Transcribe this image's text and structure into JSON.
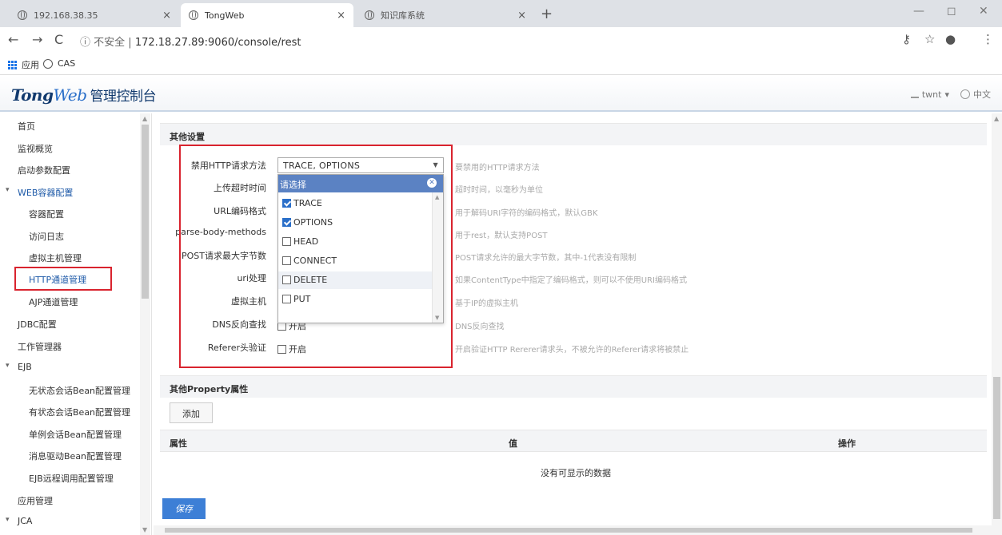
{
  "browser": {
    "tabs": [
      {
        "title": "192.168.38.35"
      },
      {
        "title": "TongWeb"
      },
      {
        "title": "知识库系统"
      }
    ],
    "url_prefix": "不安全",
    "url": "172.18.27.89:9060/console/rest",
    "bookmarks": {
      "apps": "应用",
      "cas": "CAS"
    }
  },
  "app": {
    "logo_main": "Tong",
    "logo_web": "Web",
    "logo_cn": "管理控制台",
    "user": "twnt",
    "lang": "中文"
  },
  "sidebar": {
    "items": [
      {
        "label": "首页"
      },
      {
        "label": "监视概览"
      },
      {
        "label": "启动参数配置"
      },
      {
        "label": "WEB容器配置"
      },
      {
        "label": "容器配置"
      },
      {
        "label": "访问日志"
      },
      {
        "label": "虚拟主机管理"
      },
      {
        "label": "HTTP通道管理"
      },
      {
        "label": "AJP通道管理"
      },
      {
        "label": "JDBC配置"
      },
      {
        "label": "工作管理器"
      },
      {
        "label": "EJB"
      },
      {
        "label": "无状态会话Bean配置管理"
      },
      {
        "label": "有状态会话Bean配置管理"
      },
      {
        "label": "单例会话Bean配置管理"
      },
      {
        "label": "消息驱动Bean配置管理"
      },
      {
        "label": "EJB远程调用配置管理"
      },
      {
        "label": "应用管理"
      },
      {
        "label": "JCA"
      }
    ]
  },
  "main": {
    "section_other": "其他设置",
    "rows": [
      {
        "label": "禁用HTTP请求方法",
        "hint": "要禁用的HTTP请求方法"
      },
      {
        "label": "上传超时时间",
        "hint": "超时时间，以毫秒为单位"
      },
      {
        "label": "URL编码格式",
        "hint": "用于解码URI字符的编码格式，默认GBK"
      },
      {
        "label": "parse-body-methods",
        "hint": "用于rest，默认支持POST"
      },
      {
        "label": "POST请求最大字节数",
        "hint": "POST请求允许的最大字节数，其中-1代表没有限制"
      },
      {
        "label": "uri处理",
        "hint": "如果ContentType中指定了编码格式，则可以不使用URI编码格式"
      },
      {
        "label": "虚拟主机",
        "hint": "基于IP的虚拟主机"
      },
      {
        "label": "DNS反向查找",
        "value": "开启",
        "hint": "DNS反向查找"
      },
      {
        "label": "Referer头验证",
        "value": "开启",
        "hint": "开启验证HTTP Rererer请求头，不被允许的Referer请求将被禁止"
      }
    ],
    "select_value": "TRACE, OPTIONS",
    "dropdown": {
      "placeholder": "请选择",
      "options": [
        {
          "label": "TRACE",
          "checked": true
        },
        {
          "label": "OPTIONS",
          "checked": true
        },
        {
          "label": "HEAD",
          "checked": false
        },
        {
          "label": "CONNECT",
          "checked": false
        },
        {
          "label": "DELETE",
          "checked": false
        },
        {
          "label": "PUT",
          "checked": false
        }
      ]
    },
    "section_property": "其他Property属性",
    "add_label": "添加",
    "table_headers": [
      "属性",
      "值",
      "操作"
    ],
    "empty_text": "没有可显示的数据",
    "save_label": "保存"
  },
  "colors": {
    "accent": "#3d7fd6",
    "highlight": "#d9232e",
    "dropdown_head": "#5b82c3"
  }
}
